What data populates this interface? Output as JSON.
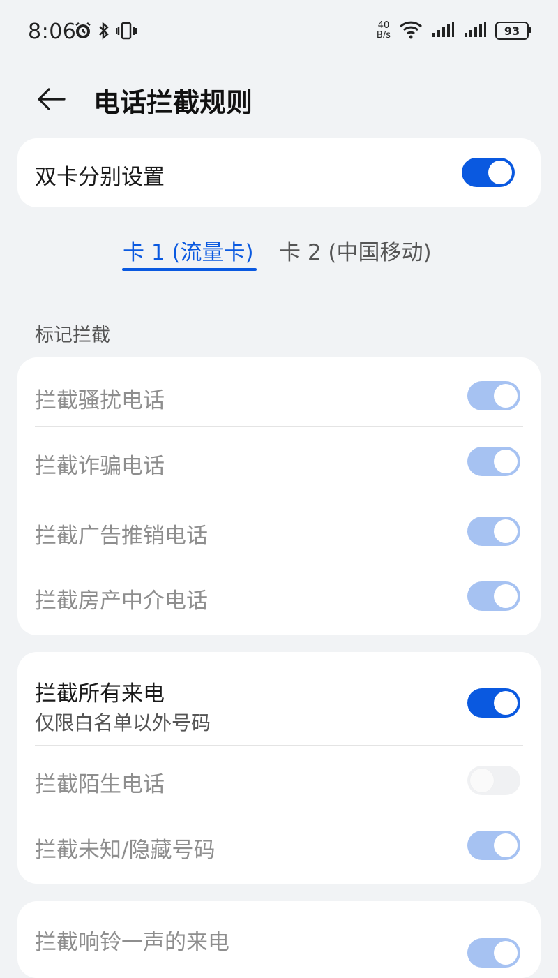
{
  "status": {
    "time": "8:06",
    "net_speed_value": "40",
    "net_speed_unit": "B/s",
    "battery": "93",
    "icons": [
      "alarm-icon",
      "bluetooth-icon",
      "vibrate-icon",
      "wifi-icon",
      "signal-icon",
      "signal-icon-2",
      "battery-icon"
    ]
  },
  "header": {
    "title": "电话拦截规则",
    "back_icon": "back-arrow-icon"
  },
  "dual_sim": {
    "label": "双卡分别设置",
    "on": true
  },
  "tabs": [
    {
      "label": "卡 1 (流量卡)",
      "active": true
    },
    {
      "label": "卡 2 (中国移动)",
      "active": false
    }
  ],
  "mark_section": {
    "title": "标记拦截",
    "items": [
      {
        "label": "拦截骚扰电话",
        "state": "on-disabled"
      },
      {
        "label": "拦截诈骗电话",
        "state": "on-disabled"
      },
      {
        "label": "拦截广告推销电话",
        "state": "on-disabled"
      },
      {
        "label": "拦截房产中介电话",
        "state": "on-disabled"
      }
    ]
  },
  "block_all": {
    "label": "拦截所有来电",
    "sublabel": "仅限白名单以外号码",
    "on": true,
    "items": [
      {
        "label": "拦截陌生电话",
        "state": "off-disabled"
      },
      {
        "label": "拦截未知/隐藏号码",
        "state": "on-disabled"
      }
    ]
  },
  "ring_once": {
    "label": "拦截响铃一声的来电",
    "state": "on-disabled"
  },
  "colors": {
    "accent": "#0a59e0",
    "accent_disabled": "#a6c2f2",
    "background": "#f1f3f5"
  }
}
